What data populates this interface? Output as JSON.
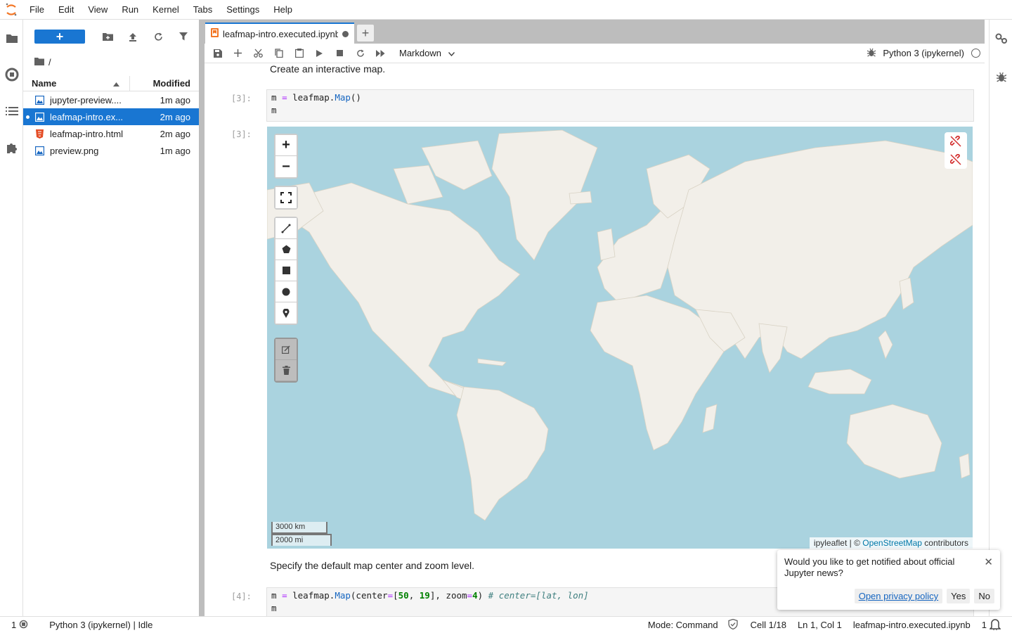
{
  "menubar": {
    "logo_icon": "jupyter-logo-icon",
    "items": [
      "File",
      "Edit",
      "View",
      "Run",
      "Kernel",
      "Tabs",
      "Settings",
      "Help"
    ]
  },
  "left_activity": [
    "folder-icon",
    "running-icon",
    "toc-icon",
    "extension-icon"
  ],
  "filebrowser": {
    "new_label": "+",
    "path": "/",
    "columns": {
      "name": "Name",
      "modified": "Modified"
    },
    "files": [
      {
        "name": "jupyter-preview....",
        "modified": "1m ago",
        "type": "image",
        "selected": false
      },
      {
        "name": "leafmap-intro.ex...",
        "modified": "2m ago",
        "type": "notebook",
        "selected": true
      },
      {
        "name": "leafmap-intro.html",
        "modified": "2m ago",
        "type": "html",
        "selected": false
      },
      {
        "name": "preview.png",
        "modified": "1m ago",
        "type": "image",
        "selected": false
      }
    ]
  },
  "tab": {
    "label": "leafmap-intro.executed.ipynb",
    "add_label": "+"
  },
  "notebook_toolbar": {
    "cell_type": "Markdown",
    "kernel": "Python 3 (ipykernel)"
  },
  "cells": {
    "md1": "Create an interactive map.",
    "prompt3_in": "[3]:",
    "prompt3_out": "[3]:",
    "md2": "Specify the default map center and zoom level.",
    "prompt4_in": "[4]:"
  },
  "map": {
    "zoom_in": "+",
    "zoom_out": "−",
    "scale_km": "3000 km",
    "scale_mi": "2000 mi",
    "attribution_prefix": "ipyleaflet | © ",
    "attribution_link": "OpenStreetMap",
    "attribution_suffix": " contributors"
  },
  "toast": {
    "message": "Would you like to get notified about official Jupyter news?",
    "close": "✕",
    "privacy": "Open privacy policy",
    "yes": "Yes",
    "no": "No"
  },
  "statusbar": {
    "terminals": "1",
    "kernel_status": "Python 3 (ipykernel) | Idle",
    "mode": "Mode: Command",
    "cell": "Cell 1/18",
    "cursor": "Ln 1, Col 1",
    "filename": "leafmap-intro.executed.ipynb",
    "notifications": "1"
  },
  "colors": {
    "accent": "#1976d2",
    "water": "#aad3df",
    "land": "#f2efe9"
  }
}
